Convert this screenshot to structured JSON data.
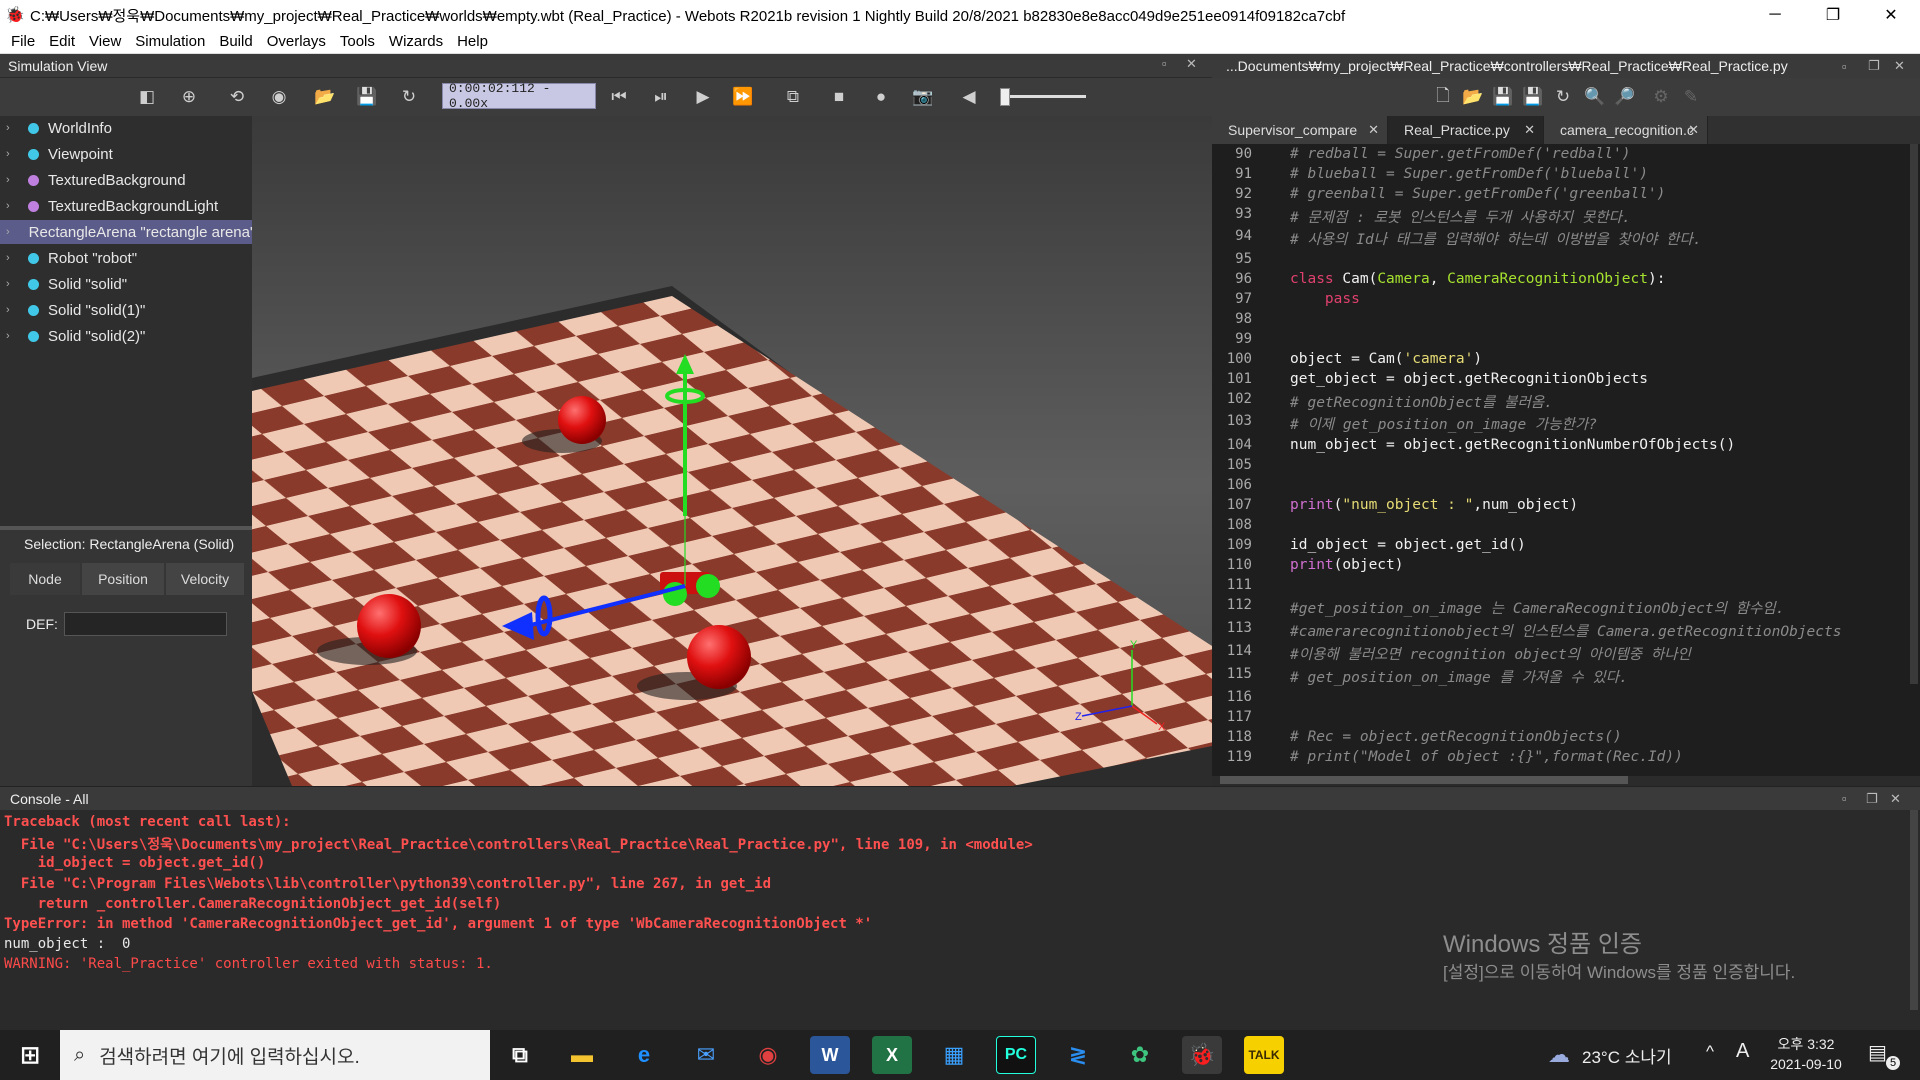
{
  "window": {
    "title": "C:₩Users₩정욱₩Documents₩my_project₩Real_Practice₩worlds₩empty.wbt (Real_Practice) - Webots R2021b revision 1 Nightly Build 20/8/2021 b82830e8e8acc049d9e251ee0914f09182ca7cbf",
    "minimize": "─",
    "restore": "❐",
    "close": "✕"
  },
  "menu": [
    "File",
    "Edit",
    "View",
    "Simulation",
    "Build",
    "Overlays",
    "Tools",
    "Wizards",
    "Help"
  ],
  "sim_view": {
    "title": "Simulation View",
    "time": "0:00:02:112  -  0.00x"
  },
  "scene_tree": [
    {
      "label": "WorldInfo",
      "color": "#41c8e8"
    },
    {
      "label": "Viewpoint",
      "color": "#41c8e8"
    },
    {
      "label": "TexturedBackground",
      "color": "#c080e0"
    },
    {
      "label": "TexturedBackgroundLight",
      "color": "#c080e0"
    },
    {
      "label": "RectangleArena \"rectangle arena\"",
      "color": "#6060d0"
    },
    {
      "label": "Robot \"robot\"",
      "color": "#41c8e8"
    },
    {
      "label": "Solid \"solid\"",
      "color": "#41c8e8"
    },
    {
      "label": "Solid \"solid(1)\"",
      "color": "#41c8e8"
    },
    {
      "label": "Solid \"solid(2)\"",
      "color": "#41c8e8"
    }
  ],
  "selection": {
    "label": "Selection: RectangleArena (Solid)",
    "tabs": [
      "Node",
      "Position",
      "Velocity"
    ],
    "def_label": "DEF:",
    "def_value": ""
  },
  "editor": {
    "path": "...Documents₩my_project₩Real_Practice₩controllers₩Real_Practice₩Real_Practice.py",
    "tabs": [
      "Supervisor_compare",
      "Real_Practice.py",
      "camera_recognition.c"
    ],
    "line_numbers": [
      "90",
      "91",
      "92",
      "93",
      "94",
      "95",
      "96",
      "97",
      "98",
      "99",
      "100",
      "101",
      "102",
      "103",
      "104",
      "105",
      "106",
      "107",
      "108",
      "109",
      "110",
      "111",
      "112",
      "113",
      "114",
      "115",
      "116",
      "117",
      "118",
      "119"
    ],
    "code_lines": [
      "# redball = Super.getFromDef('redball')",
      "# blueball = Super.getFromDef('blueball')",
      "# greenball = Super.getFromDef('greenball')",
      "# 문제점 : 로봇 인스턴스를 두개 사용하지 못한다.",
      "# 사용의 Id나 태그를 입력해야 하는데 이방법을 찾아야 한다.",
      "",
      "class Cam(Camera, CameraRecognitionObject):",
      "    pass",
      "",
      "",
      "object = Cam('camera')",
      "get_object = object.getRecognitionObjects",
      "# getRecognitionObject를 불러옴.",
      "# 이제 get_position_on_image 가능한가?",
      "num_object = object.getRecognitionNumberOfObjects()",
      "",
      "",
      "print(\"num_object : \",num_object)",
      "",
      "id_object = object.get_id()",
      "print(object)",
      "",
      "#get_position_on_image 는 CameraRecognitionObject의 함수임.",
      "#camerarecognitionobject의 인스턴스를 Camera.getRecognitionObjects",
      "#이용해 불러오면 recognition object의 아이템중 하나인",
      "# get_position_on_image 를 가져올 수 있다.",
      "",
      "",
      "# Rec = object.getRecognitionObjects()",
      "# print(\"Model of object :{}\",format(Rec.Id))"
    ]
  },
  "console": {
    "title": "Console - All",
    "lines": [
      "Traceback (most recent call last):",
      "  File \"C:\\Users\\정욱\\Documents\\my_project\\Real_Practice\\controllers\\Real_Practice\\Real_Practice.py\", line 109, in <module>",
      "    id_object = object.get_id()",
      "  File \"C:\\Program Files\\Webots\\lib\\controller\\python39\\controller.py\", line 267, in get_id",
      "    return _controller.CameraRecognitionObject_get_id(self)",
      "TypeError: in method 'CameraRecognitionObject_get_id', argument 1 of type 'WbCameraRecognitionObject *'",
      "num_object :  0",
      "WARNING: 'Real_Practice' controller exited with status: 1."
    ],
    "activation_title": "Windows 정품 인증",
    "activation_sub": "[설정]으로 이동하여 Windows를 정품 인증합니다."
  },
  "taskbar": {
    "search_placeholder": "검색하려면 여기에 입력하십시오.",
    "weather": "23°C  소나기",
    "ime": "A",
    "time": "오후 3:32",
    "date": "2021-09-10",
    "notifications": "5"
  }
}
